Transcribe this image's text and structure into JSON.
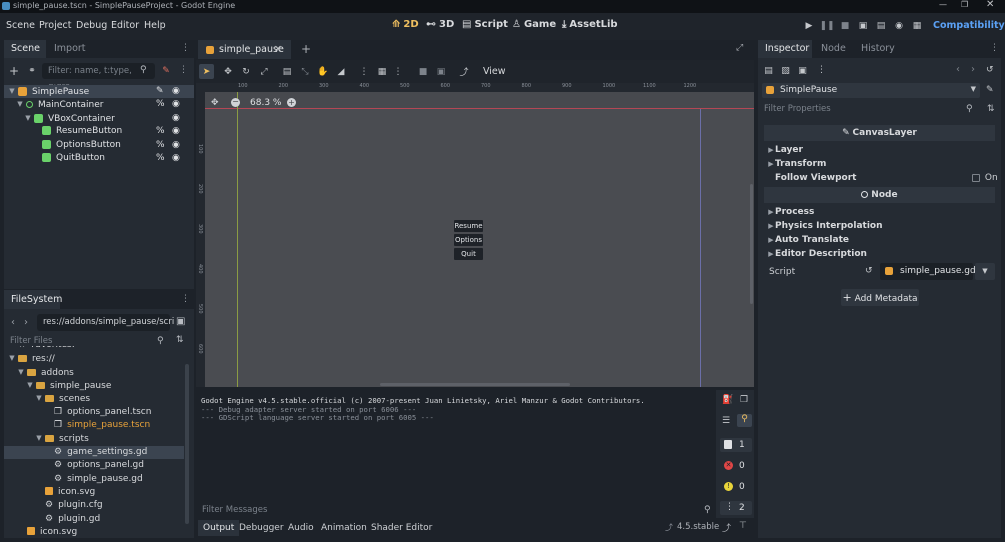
{
  "window": {
    "title": "simple_pause.tscn - SimplePauseProject - Godot Engine"
  },
  "menu": {
    "items": [
      "Scene",
      "Project",
      "Debug",
      "Editor",
      "Help"
    ]
  },
  "workspaces": [
    {
      "label": "2D",
      "active": true
    },
    {
      "label": "3D",
      "active": false
    },
    {
      "label": "Script",
      "active": false
    },
    {
      "label": "Game",
      "active": false
    },
    {
      "label": "AssetLib",
      "active": false
    }
  ],
  "renderer": {
    "label": "Compatibility"
  },
  "scene_dock": {
    "tabs": [
      "Scene",
      "Import"
    ],
    "filter_placeholder": "Filter: name, t:type, g:gro",
    "nodes": [
      {
        "name": "SimplePause",
        "indent": 0,
        "selected": true,
        "color": "#e8a23a",
        "right": "script"
      },
      {
        "name": "MainContainer",
        "indent": 1,
        "selected": false,
        "color": "#6ad26a",
        "right": "%"
      },
      {
        "name": "VBoxContainer",
        "indent": 2,
        "selected": false,
        "color": "#6ad26a",
        "right": ""
      },
      {
        "name": "ResumeButton",
        "indent": 3,
        "selected": false,
        "color": "#6ad26a",
        "right": "%"
      },
      {
        "name": "OptionsButton",
        "indent": 3,
        "selected": false,
        "color": "#6ad26a",
        "right": "%"
      },
      {
        "name": "QuitButton",
        "indent": 3,
        "selected": false,
        "color": "#6ad26a",
        "right": "%"
      }
    ]
  },
  "filesystem": {
    "tab": "FileSystem",
    "path": "res://addons/simple_pause/scri",
    "filter_placeholder": "Filter Files",
    "items": [
      {
        "name": "Favorites:",
        "indent": 0,
        "type": "fav"
      },
      {
        "name": "res://",
        "indent": 0,
        "type": "folder"
      },
      {
        "name": "addons",
        "indent": 1,
        "type": "folder"
      },
      {
        "name": "simple_pause",
        "indent": 2,
        "type": "folder"
      },
      {
        "name": "scenes",
        "indent": 3,
        "type": "folder"
      },
      {
        "name": "options_panel.tscn",
        "indent": 4,
        "type": "scene"
      },
      {
        "name": "simple_pause.tscn",
        "indent": 4,
        "type": "scene-open"
      },
      {
        "name": "scripts",
        "indent": 3,
        "type": "folder"
      },
      {
        "name": "game_settings.gd",
        "indent": 4,
        "type": "gear-selected"
      },
      {
        "name": "options_panel.gd",
        "indent": 4,
        "type": "gear"
      },
      {
        "name": "simple_pause.gd",
        "indent": 4,
        "type": "gear"
      },
      {
        "name": "icon.svg",
        "indent": 3,
        "type": "svg"
      },
      {
        "name": "plugin.cfg",
        "indent": 3,
        "type": "gear"
      },
      {
        "name": "plugin.gd",
        "indent": 3,
        "type": "gear"
      },
      {
        "name": "icon.svg",
        "indent": 1,
        "type": "svg"
      }
    ]
  },
  "editor": {
    "scene_tab": "simple_pause",
    "toolbar_view": "View",
    "zoom": "68.3 %",
    "ruler_labels": [
      "100",
      "200",
      "300",
      "400",
      "500",
      "600",
      "700",
      "800",
      "900",
      "1000",
      "1100",
      "1200"
    ],
    "left_ruler_labels": [
      "100",
      "200",
      "300",
      "400",
      "500",
      "600"
    ],
    "buttons": [
      "Resume",
      "Options",
      "Quit"
    ]
  },
  "output": {
    "lines": [
      "Godot Engine v4.5.stable.official (c) 2007-present Juan Linietsky, Ariel Manzur & Godot Contributors.",
      "--- Debug adapter server started on port 6006 ---",
      "--- GDScript language server started on port 6005 ---"
    ],
    "filter_placeholder": "Filter Messages",
    "counts": {
      "messages": "1",
      "errors": "0",
      "warnings": "0",
      "editor": "2"
    }
  },
  "bottom_tabs": [
    "Output",
    "Debugger",
    "Audio",
    "Animation",
    "Shader Editor"
  ],
  "version": "4.5.stable",
  "inspector": {
    "tabs": [
      "Inspector",
      "Node",
      "History"
    ],
    "object": "SimplePause",
    "filter_placeholder": "Filter Properties",
    "class_header": "CanvasLayer",
    "sections1": [
      "Layer",
      "Transform"
    ],
    "follow_viewport_label": "Follow Viewport",
    "follow_viewport_value": "On",
    "node_header": "Node",
    "sections2": [
      "Process",
      "Physics Interpolation",
      "Auto Translate",
      "Editor Description"
    ],
    "script_label": "Script",
    "script_value": "simple_pause.gd",
    "add_metadata": "Add Metadata"
  },
  "colors": {
    "accent": "#5ba1f5",
    "selection": "#3b4450",
    "node_icon": "#6ad26a",
    "scene_icon": "#e8a23a",
    "folder": "#d9a441",
    "error": "#e04646",
    "warning": "#e8d43a"
  }
}
